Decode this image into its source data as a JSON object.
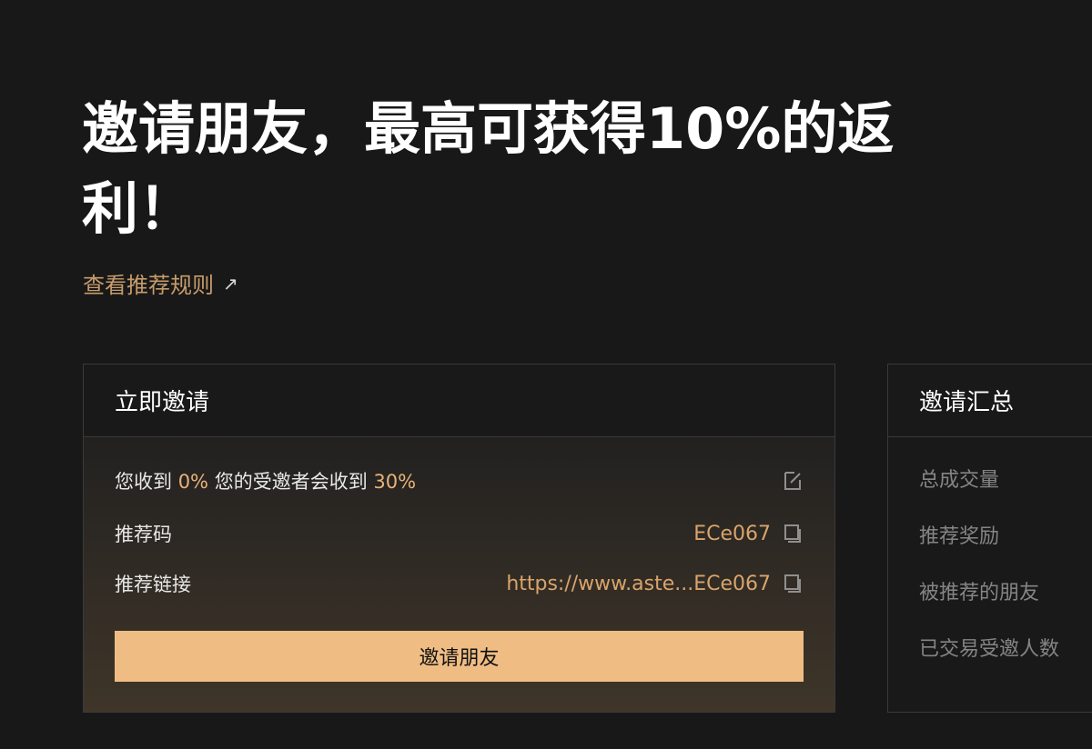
{
  "hero": {
    "title": "邀请朋友，最高可获得10%的返利！",
    "rules_link": "查看推荐规则",
    "rules_arrow": "↗"
  },
  "invite_card": {
    "title": "立即邀请",
    "rate_prefix": "您收到",
    "your_rate": "0%",
    "rate_middle": "您的受邀者会收到",
    "invitee_rate": "30%",
    "code_label": "推荐码",
    "code_value": "ECe067",
    "link_label": "推荐链接",
    "link_value": "https://www.aste...ECe067",
    "button_label": "邀请朋友"
  },
  "summary_card": {
    "title": "邀请汇总",
    "items": [
      "总成交量",
      "推荐奖励",
      "被推荐的朋友",
      "已交易受邀人数"
    ]
  },
  "colors": {
    "background": "#181818",
    "accent": "#efbd84",
    "accent_text": "#e8b27a",
    "muted_text": "#858585"
  },
  "icons": [
    "edit-icon",
    "copy-icon",
    "external-arrow-icon"
  ]
}
